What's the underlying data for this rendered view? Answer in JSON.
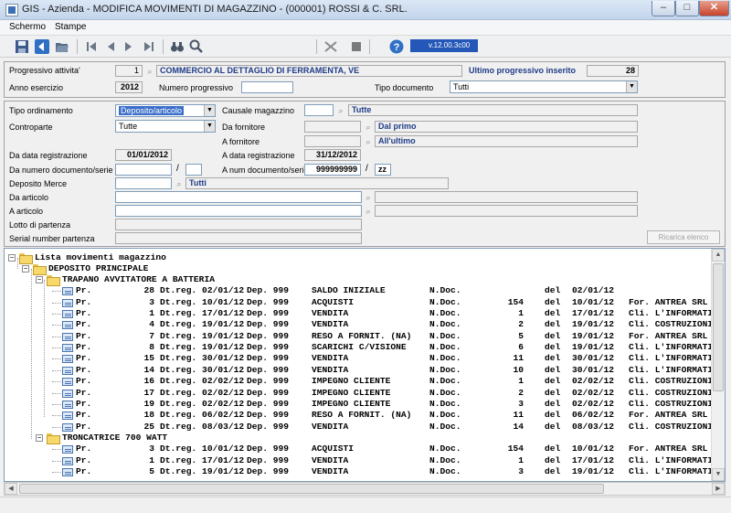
{
  "window": {
    "title": "GIS - Azienda - MODIFICA MOVIMENTI DI MAGAZZINO - (000001) ROSSI & C. SRL.",
    "minimize": "–",
    "maximize": "□",
    "close": "✕"
  },
  "menu": [
    "Schermo",
    "Stampe"
  ],
  "toolbar": {
    "icons": [
      "save-icon",
      "back-icon",
      "open-icon",
      "first-record-icon",
      "previous-record-icon",
      "next-record-icon",
      "last-record-icon",
      "binoculars-icon",
      "zoom-icon",
      "cut-icon",
      "stop-icon",
      "help-icon"
    ],
    "version": "v.12.00.3c00"
  },
  "header": {
    "progressivo_label": "Progressivo attivita'",
    "progressivo_value": "1",
    "attivita_value": "COMMERCIO AL DETTAGLIO DI FERRAMENTA, VE",
    "ultimo_label": "Ultimo progressivo inserito",
    "ultimo_value": "28",
    "anno_label": "Anno esercizio",
    "anno_value": "2012",
    "numero_label": "Numero progressivo",
    "numero_value": "",
    "tipo_doc_label": "Tipo documento",
    "tipo_doc_value": "Tutti"
  },
  "filters": {
    "tipo_ordinamento_label": "Tipo ordinamento",
    "tipo_ordinamento_value": "Deposito/articolo",
    "causale_label": "Causale magazzino",
    "causale_code": "",
    "causale_desc": "Tutte",
    "controparte_label": "Controparte",
    "controparte_value": "Tutte",
    "da_fornitore_label": "Da fornitore",
    "da_fornitore_desc": "Dal primo",
    "a_fornitore_label": "A fornitore",
    "a_fornitore_desc": "All'ultimo",
    "da_data_label": "Da data registrazione",
    "da_data_value": "01/01/2012",
    "a_data_label": "A data registrazione",
    "a_data_value": "31/12/2012",
    "da_num_label": "Da numero documento/serie",
    "da_num_value": "",
    "da_serie_value": "",
    "a_num_label": "A num documento/serie",
    "a_num_value": "999999999",
    "a_serie_value": "zz",
    "deposito_label": "Deposito Merce",
    "deposito_desc": "Tutti",
    "da_articolo_label": "Da articolo",
    "a_articolo_label": "A articolo",
    "lotto_label": "Lotto di partenza",
    "serial_label": "Serial number partenza",
    "ricarica_button": "Ricarica elenco"
  },
  "tree": {
    "root": "Lista movimenti magazzino",
    "deposito": "DEPOSITO PRINCIPALE",
    "groups": [
      {
        "article": "TRAPANO AVVITATORE A BATTERIA",
        "rows": [
          {
            "pr": "Pr.",
            "num": "28",
            "dt": "Dt.reg. 02/01/12",
            "dep": "Dep. 999",
            "causale": "SALDO INIZIALE",
            "ndoc": "N.Doc.",
            "docnum": "",
            "del": "del",
            "date": "02/01/12",
            "party": ""
          },
          {
            "pr": "Pr.",
            "num": "3",
            "dt": "Dt.reg. 10/01/12",
            "dep": "Dep. 999",
            "causale": "ACQUISTI",
            "ndoc": "N.Doc.",
            "docnum": "154",
            "del": "del",
            "date": "10/01/12",
            "party": "For. ANTREA SRL"
          },
          {
            "pr": "Pr.",
            "num": "1",
            "dt": "Dt.reg. 17/01/12",
            "dep": "Dep. 999",
            "causale": "VENDITA",
            "ndoc": "N.Doc.",
            "docnum": "1",
            "del": "del",
            "date": "17/01/12",
            "party": "Cli. L'INFORMATI"
          },
          {
            "pr": "Pr.",
            "num": "4",
            "dt": "Dt.reg. 19/01/12",
            "dep": "Dep. 999",
            "causale": "VENDITA",
            "ndoc": "N.Doc.",
            "docnum": "2",
            "del": "del",
            "date": "19/01/12",
            "party": "Cli. COSTRUZIONI"
          },
          {
            "pr": "Pr.",
            "num": "7",
            "dt": "Dt.reg. 19/01/12",
            "dep": "Dep. 999",
            "causale": "RESO A FORNIT. (NA)",
            "ndoc": "N.Doc.",
            "docnum": "5",
            "del": "del",
            "date": "19/01/12",
            "party": "For. ANTREA SRL"
          },
          {
            "pr": "Pr.",
            "num": "8",
            "dt": "Dt.reg. 19/01/12",
            "dep": "Dep. 999",
            "causale": "SCARICHI C/VISIONE",
            "ndoc": "N.Doc.",
            "docnum": "6",
            "del": "del",
            "date": "19/01/12",
            "party": "Cli. L'INFORMATI"
          },
          {
            "pr": "Pr.",
            "num": "15",
            "dt": "Dt.reg. 30/01/12",
            "dep": "Dep. 999",
            "causale": "VENDITA",
            "ndoc": "N.Doc.",
            "docnum": "11",
            "del": "del",
            "date": "30/01/12",
            "party": "Cli. L'INFORMATI"
          },
          {
            "pr": "Pr.",
            "num": "14",
            "dt": "Dt.reg. 30/01/12",
            "dep": "Dep. 999",
            "causale": "VENDITA",
            "ndoc": "N.Doc.",
            "docnum": "10",
            "del": "del",
            "date": "30/01/12",
            "party": "Cli. L'INFORMATI"
          },
          {
            "pr": "Pr.",
            "num": "16",
            "dt": "Dt.reg. 02/02/12",
            "dep": "Dep. 999",
            "causale": "IMPEGNO CLIENTE",
            "ndoc": "N.Doc.",
            "docnum": "1",
            "del": "del",
            "date": "02/02/12",
            "party": "Cli. COSTRUZIONI"
          },
          {
            "pr": "Pr.",
            "num": "17",
            "dt": "Dt.reg. 02/02/12",
            "dep": "Dep. 999",
            "causale": "IMPEGNO CLIENTE",
            "ndoc": "N.Doc.",
            "docnum": "2",
            "del": "del",
            "date": "02/02/12",
            "party": "Cli. COSTRUZIONI"
          },
          {
            "pr": "Pr.",
            "num": "19",
            "dt": "Dt.reg. 02/02/12",
            "dep": "Dep. 999",
            "causale": "IMPEGNO CLIENTE",
            "ndoc": "N.Doc.",
            "docnum": "3",
            "del": "del",
            "date": "02/02/12",
            "party": "Cli. COSTRUZIONI"
          },
          {
            "pr": "Pr.",
            "num": "18",
            "dt": "Dt.reg. 06/02/12",
            "dep": "Dep. 999",
            "causale": "RESO A FORNIT. (NA)",
            "ndoc": "N.Doc.",
            "docnum": "11",
            "del": "del",
            "date": "06/02/12",
            "party": "For. ANTREA SRL"
          },
          {
            "pr": "Pr.",
            "num": "25",
            "dt": "Dt.reg. 08/03/12",
            "dep": "Dep. 999",
            "causale": "VENDITA",
            "ndoc": "N.Doc.",
            "docnum": "14",
            "del": "del",
            "date": "08/03/12",
            "party": "Cli. COSTRUZIONI"
          }
        ]
      },
      {
        "article": "TRONCATRICE 700 WATT",
        "rows": [
          {
            "pr": "Pr.",
            "num": "3",
            "dt": "Dt.reg. 10/01/12",
            "dep": "Dep. 999",
            "causale": "ACQUISTI",
            "ndoc": "N.Doc.",
            "docnum": "154",
            "del": "del",
            "date": "10/01/12",
            "party": "For. ANTREA SRL"
          },
          {
            "pr": "Pr.",
            "num": "1",
            "dt": "Dt.reg. 17/01/12",
            "dep": "Dep. 999",
            "causale": "VENDITA",
            "ndoc": "N.Doc.",
            "docnum": "1",
            "del": "del",
            "date": "17/01/12",
            "party": "Cli. L'INFORMATI"
          },
          {
            "pr": "Pr.",
            "num": "5",
            "dt": "Dt.reg. 19/01/12",
            "dep": "Dep. 999",
            "causale": "VENDITA",
            "ndoc": "N.Doc.",
            "docnum": "3",
            "del": "del",
            "date": "19/01/12",
            "party": "Cli. L'INFORMATI"
          }
        ]
      }
    ]
  }
}
